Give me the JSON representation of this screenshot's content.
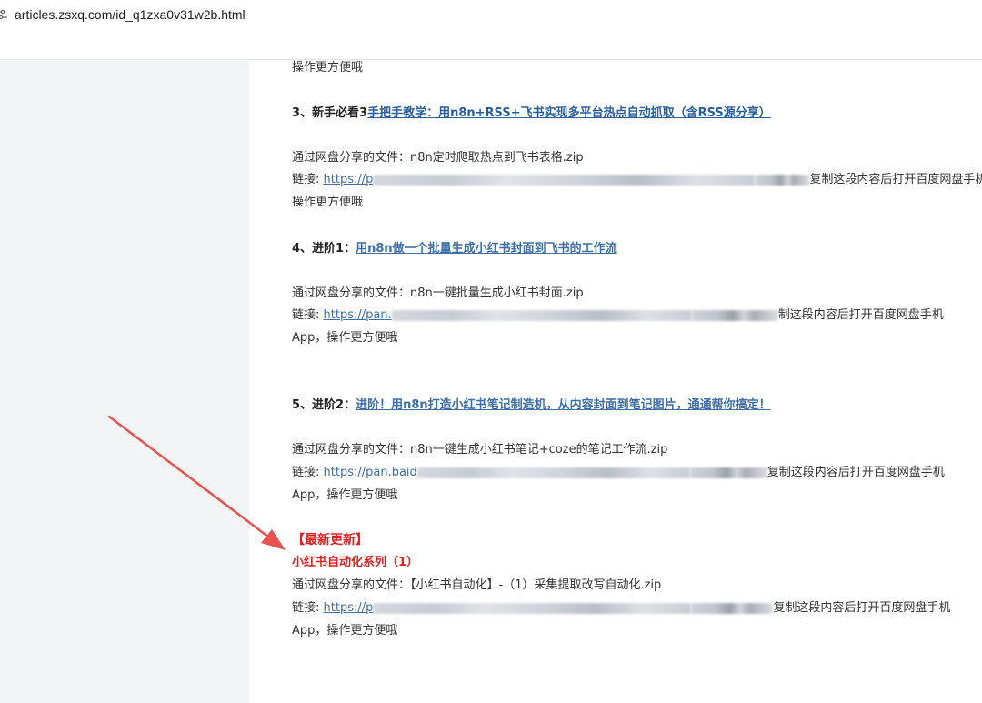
{
  "browser": {
    "url": "articles.zsxq.com/id_q1zxa0v31w2b.html"
  },
  "article": {
    "line_top_tail": "操作更方便哦",
    "item3": {
      "prefix": "3、新手必看3",
      "link": "手把手教学：用n8n+RSS+飞书实现多平台热点自动抓取（含RSS源分享）",
      "file_line": "通过网盘分享的文件：n8n定时爬取热点到飞书表格.zip",
      "link_label": "链接: ",
      "link_url": "https://p",
      "tail": "复制这段内容后打开百度网盘手机App，",
      "tail2": "操作更方便哦"
    },
    "item4": {
      "prefix": "4、进阶1：",
      "link": "用n8n做一个批量生成小红书封面到飞书的工作流",
      "file_line": "通过网盘分享的文件：n8n一键批量生成小红书封面.zip",
      "link_label": "链接: ",
      "link_url": "https://pan.",
      "tail": "制这段内容后打开百度网盘手机",
      "tail2": "App，操作更方便哦"
    },
    "item5": {
      "prefix": "5、进阶2：",
      "link": "进阶！用n8n打造小红书笔记制造机，从内容封面到笔记图片，通通帮你搞定！",
      "file_line": "通过网盘分享的文件：n8n一键生成小红书笔记+coze的笔记工作流.zip",
      "link_label": "链接: ",
      "link_url": "https://pan.baid",
      "tail": "复制这段内容后打开百度网盘手机",
      "tail2": "App，操作更方便哦"
    },
    "latest": {
      "heading": "【最新更新】",
      "series": "小红书自动化系列（1）",
      "file_line": "通过网盘分享的文件：【小红书自动化】-（1）采集提取改写自动化.zip",
      "link_label": "链接: ",
      "link_url": "https://p",
      "tail": "复制这段内容后打开百度网盘手机",
      "tail2": "App，操作更方便哦"
    }
  },
  "colors": {
    "link": "#3d6ea8",
    "accent_red": "#e02020",
    "sidebar_bg": "#f3f4f6"
  }
}
